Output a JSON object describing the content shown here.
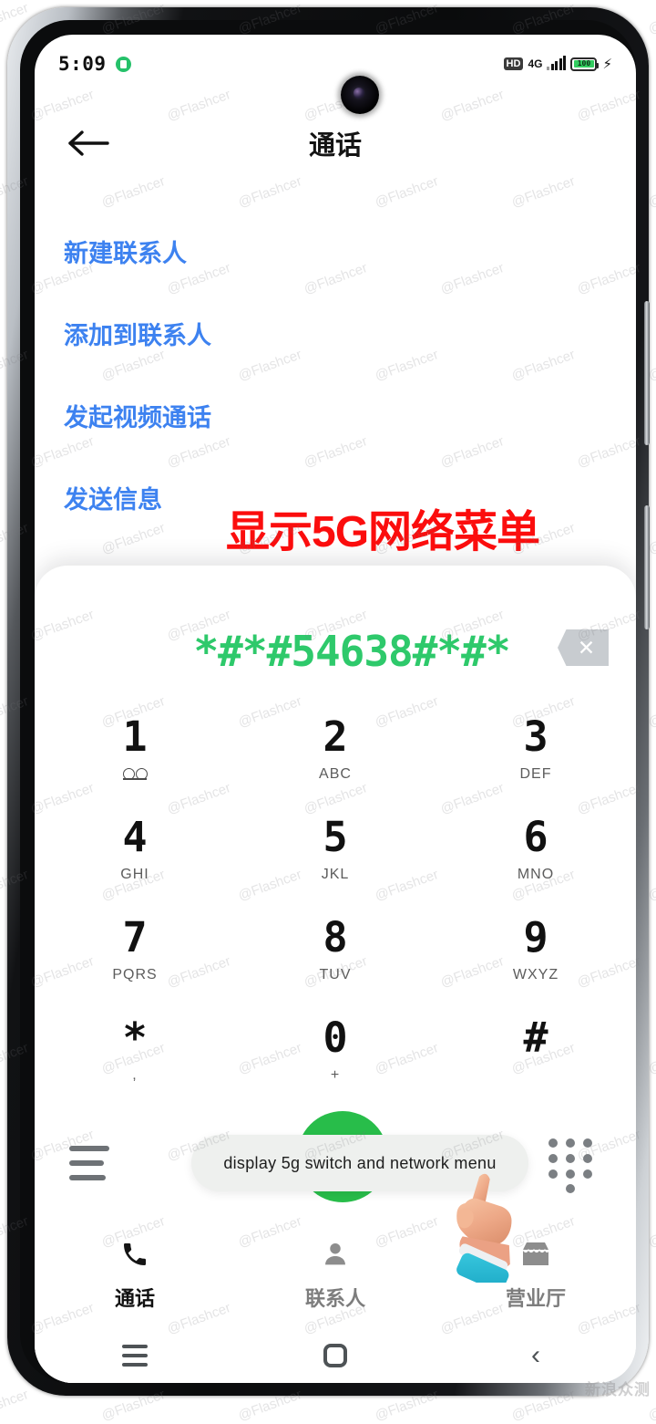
{
  "status_bar": {
    "time": "5:09",
    "badge_icon": "app-badge-icon",
    "hd_label": "HD",
    "network_label": "4G",
    "signal_icon": "signal-bars-icon",
    "battery_level": "100",
    "charging_icon": "charging-bolt-icon"
  },
  "header": {
    "back_icon": "back-arrow-icon",
    "title": "通话"
  },
  "menu": {
    "items": [
      {
        "label": "新建联系人"
      },
      {
        "label": "添加到联系人"
      },
      {
        "label": "发起视频通话"
      },
      {
        "label": "发送信息"
      }
    ]
  },
  "annotation": {
    "text": "显示5G网络菜单",
    "color": "#fb0d0d"
  },
  "dialer": {
    "dialed_number": "*#*#54638#*#*",
    "number_color": "#2ec96b",
    "backspace_icon": "backspace-icon",
    "keys": [
      {
        "digit": "1",
        "sub": "",
        "sub_icon": "voicemail-icon"
      },
      {
        "digit": "2",
        "sub": "ABC",
        "sub_icon": ""
      },
      {
        "digit": "3",
        "sub": "DEF",
        "sub_icon": ""
      },
      {
        "digit": "4",
        "sub": "GHI",
        "sub_icon": ""
      },
      {
        "digit": "5",
        "sub": "JKL",
        "sub_icon": ""
      },
      {
        "digit": "6",
        "sub": "MNO",
        "sub_icon": ""
      },
      {
        "digit": "7",
        "sub": "PQRS",
        "sub_icon": ""
      },
      {
        "digit": "8",
        "sub": "TUV",
        "sub_icon": ""
      },
      {
        "digit": "9",
        "sub": "WXYZ",
        "sub_icon": ""
      },
      {
        "digit": "*",
        "sub": ",",
        "sub_icon": ""
      },
      {
        "digit": "0",
        "sub": "+",
        "sub_icon": ""
      },
      {
        "digit": "#",
        "sub": "",
        "sub_icon": ""
      }
    ],
    "menu_icon": "hamburger-menu-icon",
    "call_icon": "phone-call-icon",
    "call_button_color": "#28bd4a",
    "keypad_icon": "keypad-dots-icon"
  },
  "tooltip": {
    "text": "display 5g switch and network menu"
  },
  "cursor": {
    "icon": "pointing-hand-emoji"
  },
  "tabs": [
    {
      "label": "通话",
      "icon": "phone-icon",
      "active": true
    },
    {
      "label": "联系人",
      "icon": "person-icon",
      "active": false
    },
    {
      "label": "营业厅",
      "icon": "store-icon",
      "active": false
    }
  ],
  "nav_bar": {
    "recents_icon": "recents-icon",
    "home_icon": "home-icon",
    "back_icon": "nav-back-icon"
  },
  "watermark": {
    "text": "@Flashcer",
    "corner_text": "新浪众测"
  }
}
